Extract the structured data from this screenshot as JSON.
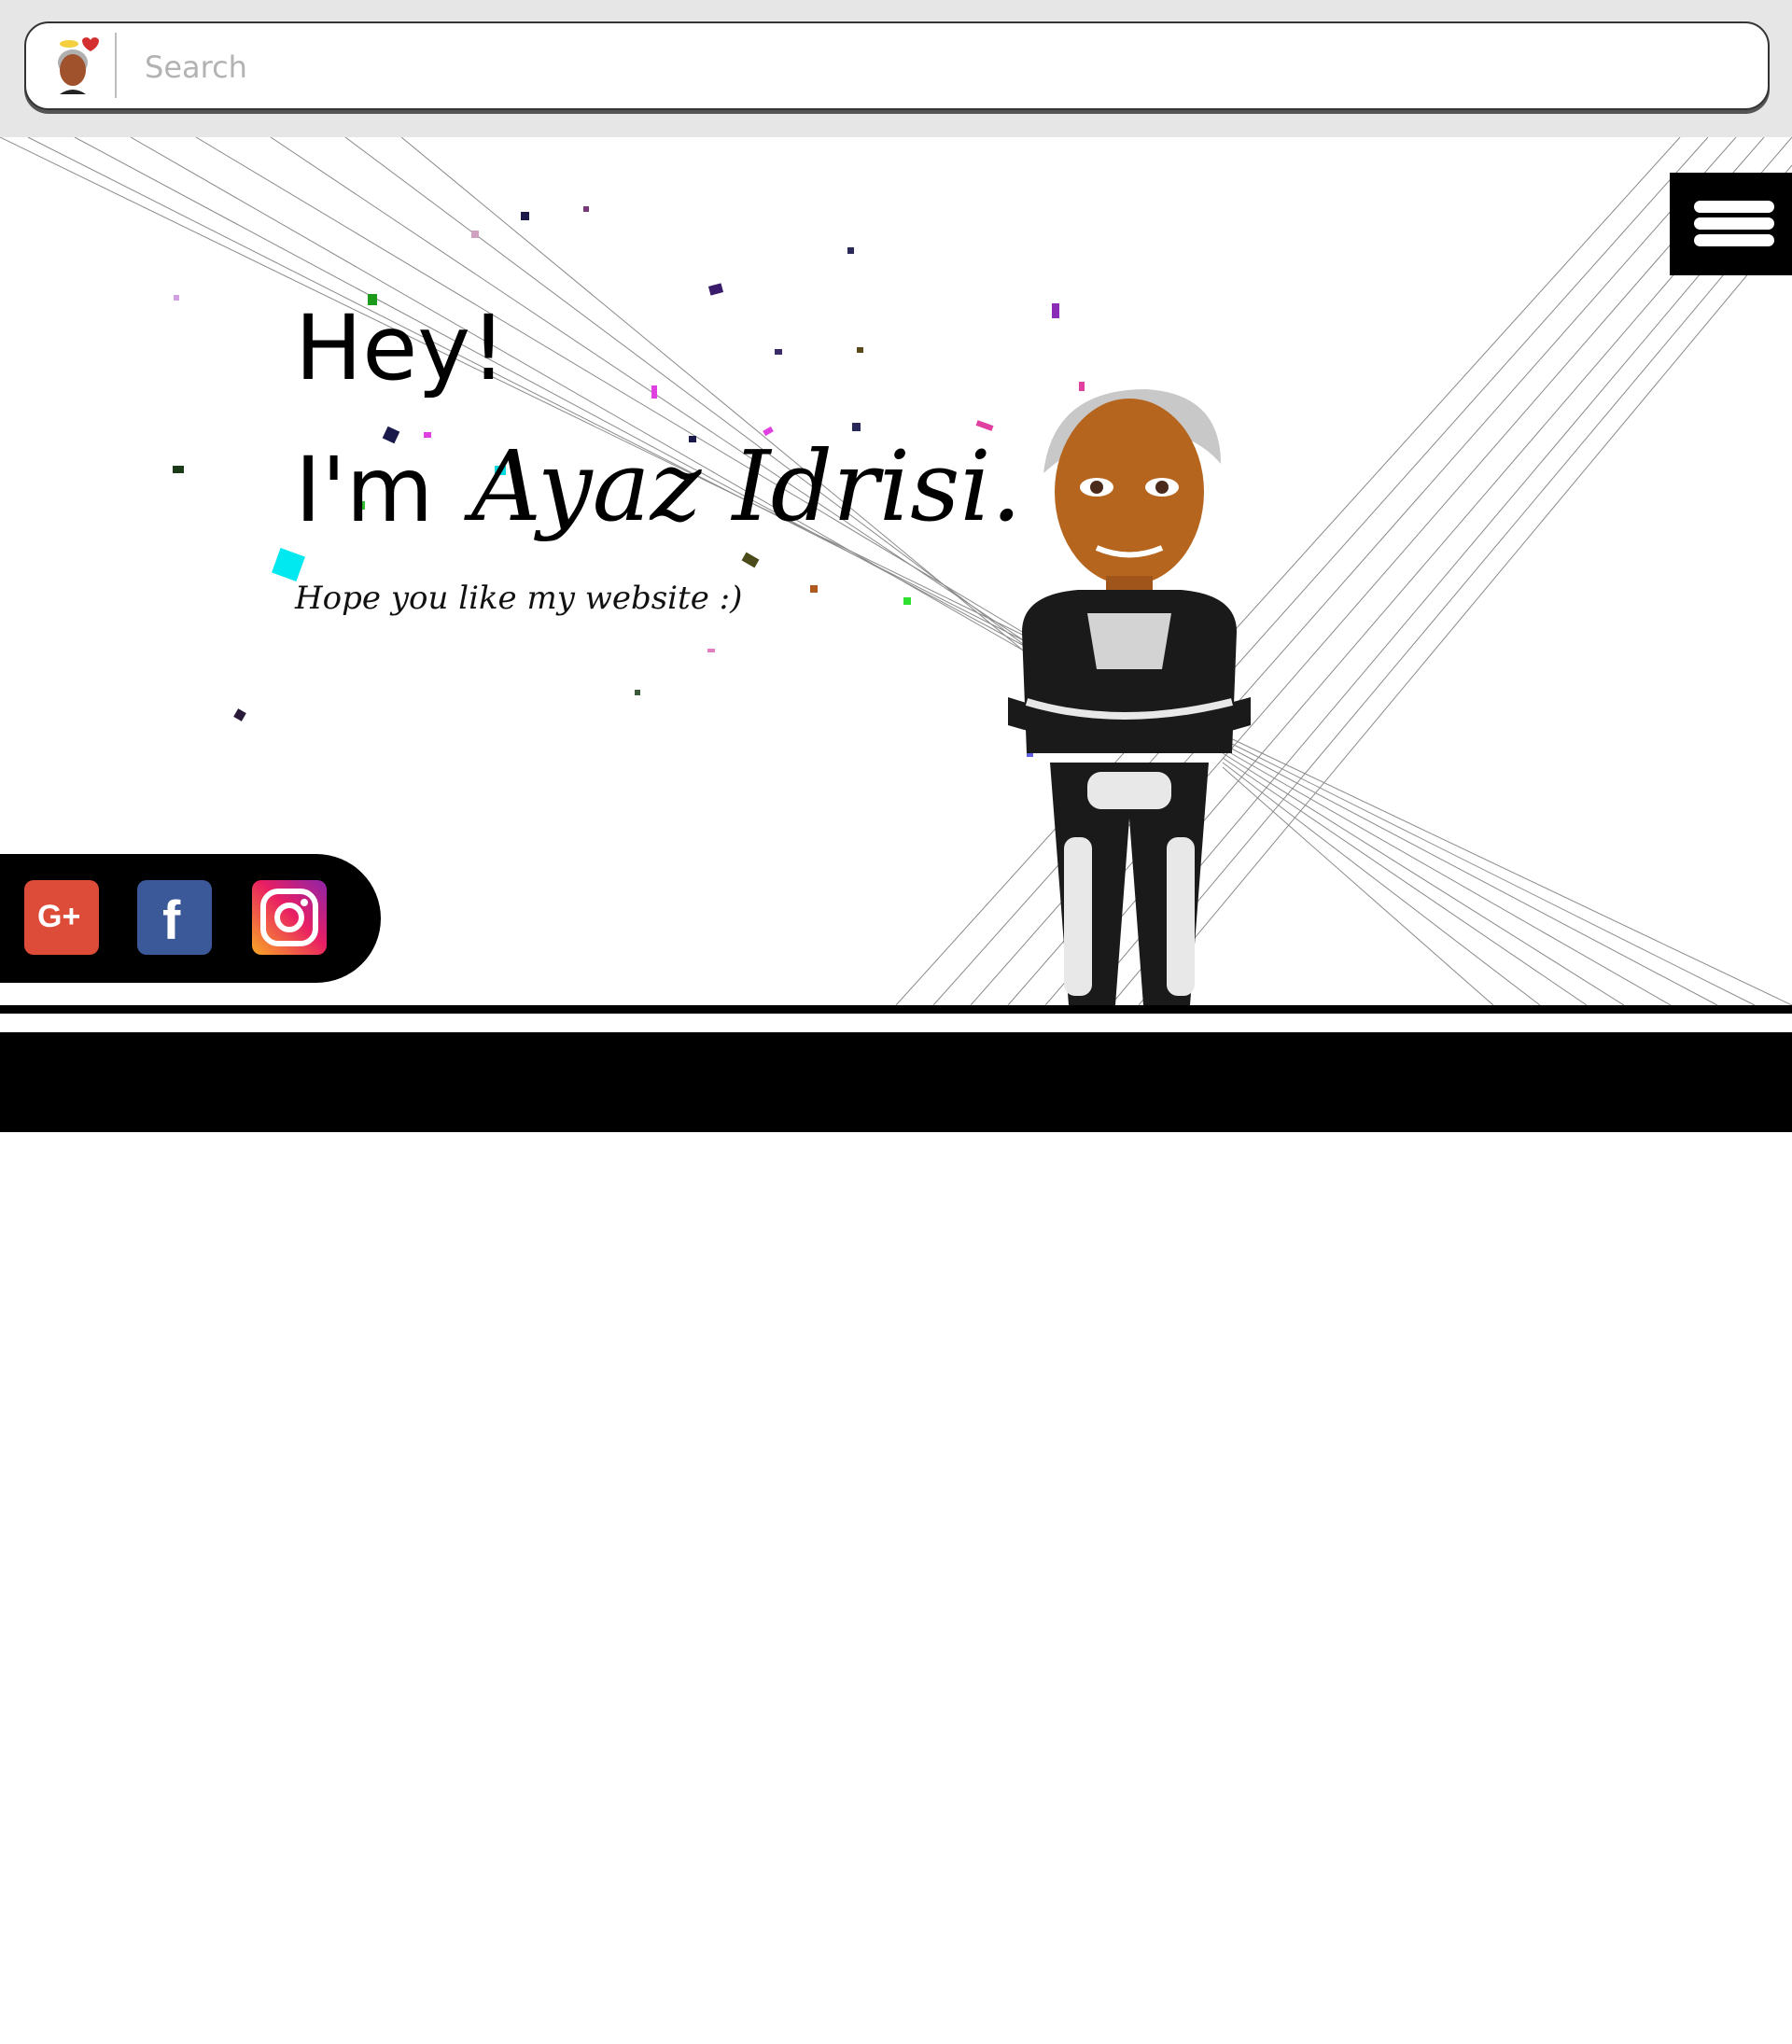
{
  "search": {
    "placeholder": "Search"
  },
  "hero": {
    "greeting_line1": "Hey!",
    "greeting_line2": "I'm",
    "name": "Ayaz Idrisi.",
    "tagline": "Hope you like my website :)"
  },
  "colors": {
    "page_background": "#ffffff",
    "top_band": "#e6e6e6",
    "accent": "#000000",
    "google_plus": "#dd4b39",
    "facebook": "#3b5998",
    "instagram": "#e91e63"
  },
  "icons": {
    "menu": "hamburger-menu-icon",
    "google_plus": "google-plus-icon",
    "facebook": "facebook-icon",
    "instagram": "instagram-icon",
    "avatar": "bitmoji-avatar-icon"
  }
}
